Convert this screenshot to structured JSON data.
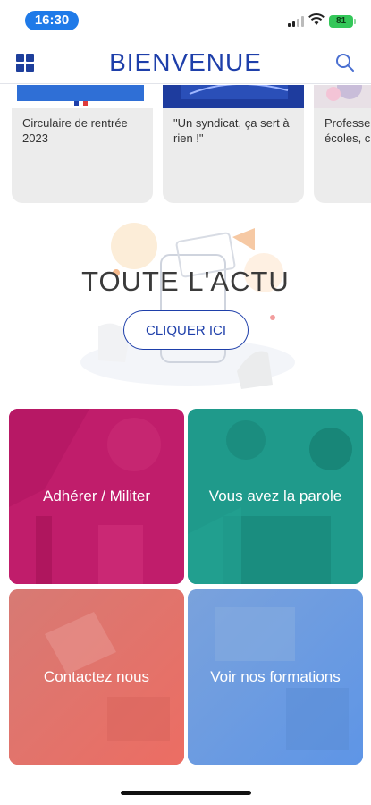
{
  "status_bar": {
    "time": "16:30",
    "battery": "81"
  },
  "header": {
    "title": "BIENVENUE",
    "menu_icon": "grid-icon",
    "search_icon": "search-icon"
  },
  "news": [
    {
      "title": "Circulaire de rentrée 2023"
    },
    {
      "title": "\"Un syndicat, ça sert à rien !\""
    },
    {
      "title": "Professeurs des écoles, c la retraite"
    }
  ],
  "actu": {
    "title": "TOUTE L'ACTU",
    "button": "CLIQUER ICI"
  },
  "tiles": [
    {
      "label": "Adhérer / Militer",
      "color": "#c01d6b"
    },
    {
      "label": "Vous avez la parole",
      "color": "#1f9a8b"
    },
    {
      "label": "Contactez nous",
      "color": "#e0736e"
    },
    {
      "label": "Voir nos formations",
      "color": "#6a9ce0"
    }
  ]
}
